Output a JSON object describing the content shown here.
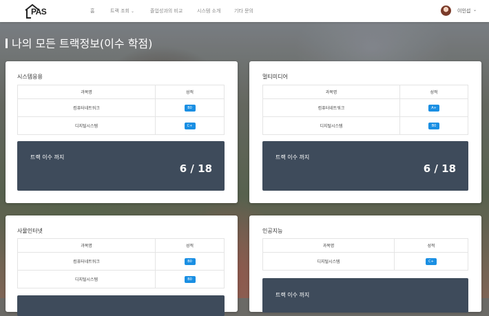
{
  "app": {
    "logo_text": "PAS"
  },
  "nav": {
    "menu": [
      {
        "label": "홈",
        "has_dropdown": false
      },
      {
        "label": "트랙 조회",
        "has_dropdown": true
      },
      {
        "label": "졸업성과의 비교",
        "has_dropdown": false
      },
      {
        "label": "시스템 소개",
        "has_dropdown": false
      },
      {
        "label": "기타 문의",
        "has_dropdown": false
      }
    ],
    "user_name": "이인섭"
  },
  "page": {
    "title": "나의 모든 트랙정보(이수 학점)"
  },
  "table_headers": {
    "course": "과목명",
    "grade": "성적"
  },
  "summary_label": "트랙 이수 까지",
  "cards": [
    {
      "title": "시스템응용",
      "courses": [
        {
          "name": "컴퓨터네트워크",
          "grade": "B0"
        },
        {
          "name": "디지털시스템",
          "grade": "C+"
        }
      ],
      "progress": "6 / 18"
    },
    {
      "title": "멀티미디어",
      "courses": [
        {
          "name": "컴퓨터네트워크",
          "grade": "A+"
        },
        {
          "name": "디지털시스템",
          "grade": "B0"
        }
      ],
      "progress": "6 / 18"
    },
    {
      "title": "사물인터넷",
      "courses": [
        {
          "name": "컴퓨터네트워크",
          "grade": "B0"
        },
        {
          "name": "디지털시스템",
          "grade": "B0"
        }
      ],
      "progress": ""
    },
    {
      "title": "인공지능",
      "courses": [
        {
          "name": "디지털시스템",
          "grade": "C+"
        }
      ],
      "progress": ""
    }
  ],
  "colors": {
    "badge": "#1a8fe3",
    "summary_bg": "#3e4b5b",
    "nav_bg": "#ffffff"
  }
}
